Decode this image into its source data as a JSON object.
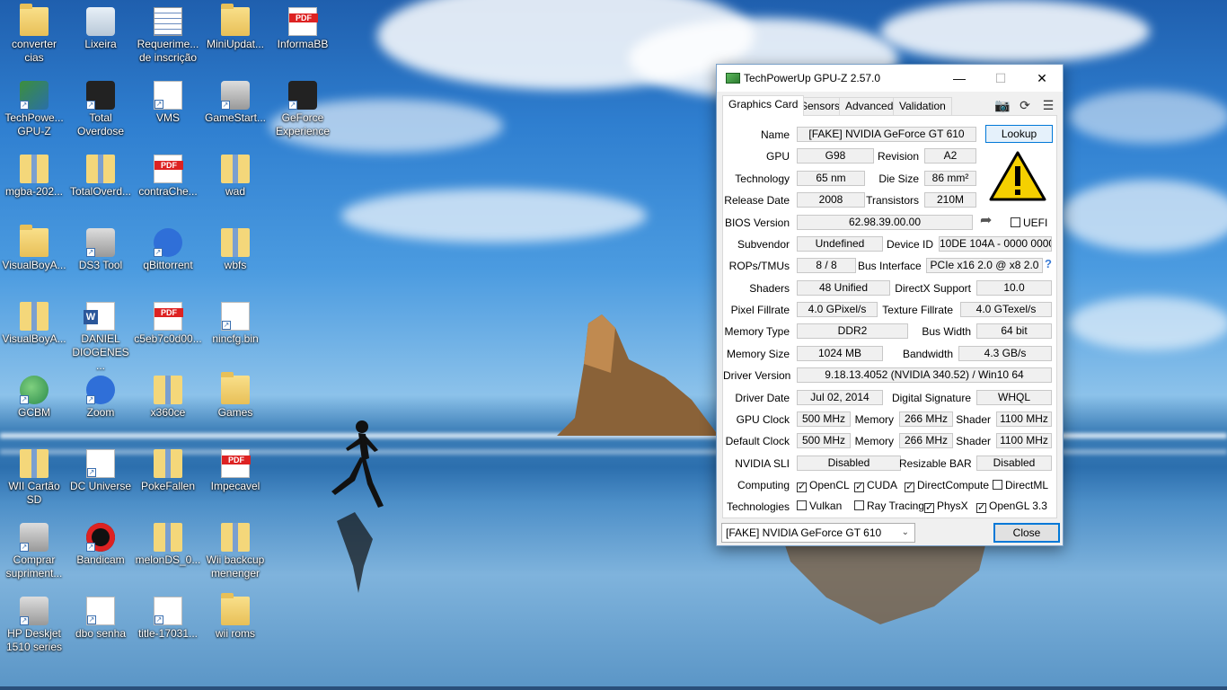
{
  "desktop": {
    "icons": [
      {
        "label": "converter\ncias",
        "glyph": "folder"
      },
      {
        "label": "Lixeira",
        "glyph": "bin"
      },
      {
        "label": "Requerime...\nde inscrição",
        "glyph": "form"
      },
      {
        "label": "MiniUpdat...",
        "glyph": "folder"
      },
      {
        "label": "InformaBB",
        "glyph": "pdf"
      },
      {
        "label": "TechPowe...\nGPU-Z",
        "glyph": "app"
      },
      {
        "label": "Total\nOverdose",
        "glyph": "dark"
      },
      {
        "label": "VMS",
        "glyph": "doc"
      },
      {
        "label": "GameStart...",
        "glyph": "gray"
      },
      {
        "label": "GeForce\nExperience",
        "glyph": "dark"
      },
      {
        "label": "mgba-202...",
        "glyph": "zip"
      },
      {
        "label": "TotalOverd...",
        "glyph": "zip"
      },
      {
        "label": "contraChe...",
        "glyph": "pdf"
      },
      {
        "label": "wad",
        "glyph": "zip"
      },
      {
        "label": "VisualBoyA...",
        "glyph": "folder"
      },
      {
        "label": "DS3 Tool",
        "glyph": "gray"
      },
      {
        "label": "qBittorrent",
        "glyph": "blue-circle"
      },
      {
        "label": "wbfs",
        "glyph": "zip"
      },
      {
        "label": "VisualBoyA...",
        "glyph": "zip"
      },
      {
        "label": "DANIEL\nDIOGENES ...",
        "glyph": "word"
      },
      {
        "label": "c5eb7c0d00...",
        "glyph": "pdf"
      },
      {
        "label": "nincfg.bin",
        "glyph": "doc"
      },
      {
        "label": "GCBM",
        "glyph": "globe"
      },
      {
        "label": "Zoom",
        "glyph": "blue-circle"
      },
      {
        "label": "x360ce",
        "glyph": "zip"
      },
      {
        "label": "Games",
        "glyph": "folder"
      },
      {
        "label": "WII Cartão\nSD",
        "glyph": "zip"
      },
      {
        "label": "DC Universe",
        "glyph": "doc"
      },
      {
        "label": "PokeFallen",
        "glyph": "zip"
      },
      {
        "label": "Impecavel",
        "glyph": "pdf"
      },
      {
        "label": "Comprar\nsupriment...",
        "glyph": "gray"
      },
      {
        "label": "Bandicam",
        "glyph": "bandicam"
      },
      {
        "label": "melonDS_0...",
        "glyph": "zip"
      },
      {
        "label": "Wii backcup\nmenenger",
        "glyph": "zip"
      },
      {
        "label": "HP Deskjet\n1510 series",
        "glyph": "gray"
      },
      {
        "label": "dbo senha",
        "glyph": "doc"
      },
      {
        "label": "title-17031...",
        "glyph": "doc"
      },
      {
        "label": "wii roms",
        "glyph": "folder"
      }
    ]
  },
  "window": {
    "title": "TechPowerUp GPU-Z 2.57.0",
    "controls": {
      "minimize": "—",
      "maximize": "☐",
      "close": "✕"
    },
    "tabs": [
      "Graphics Card",
      "Sensors",
      "Advanced",
      "Validation"
    ],
    "active_tab": "Graphics Card",
    "tool_icons": [
      "camera-icon",
      "refresh-icon",
      "menu-icon"
    ],
    "labels": {
      "name": "Name",
      "gpu": "GPU",
      "revision": "Revision",
      "technology": "Technology",
      "die_size": "Die Size",
      "release_date": "Release Date",
      "transistors": "Transistors",
      "bios_version": "BIOS Version",
      "uefi": "UEFI",
      "subvendor": "Subvendor",
      "device_id": "Device ID",
      "rops_tmus": "ROPs/TMUs",
      "bus_interface": "Bus Interface",
      "shaders": "Shaders",
      "directx_support": "DirectX Support",
      "pixel_fillrate": "Pixel Fillrate",
      "texture_fillrate": "Texture Fillrate",
      "memory_type": "Memory Type",
      "bus_width": "Bus Width",
      "memory_size": "Memory Size",
      "bandwidth": "Bandwidth",
      "driver_version": "Driver Version",
      "driver_date": "Driver Date",
      "digital_signature": "Digital Signature",
      "gpu_clock": "GPU Clock",
      "memory": "Memory",
      "shader": "Shader",
      "default_clock": "Default Clock",
      "nvidia_sli": "NVIDIA SLI",
      "resizable_bar": "Resizable BAR",
      "computing": "Computing",
      "technologies": "Technologies"
    },
    "values": {
      "name": "[FAKE] NVIDIA GeForce GT 610",
      "gpu": "G98",
      "revision": "A2",
      "technology": "65 nm",
      "die_size": "86 mm²",
      "release_date": "2008",
      "transistors": "210M",
      "bios_version": "62.98.39.00.00",
      "subvendor": "Undefined",
      "device_id": "10DE 104A - 0000 0000",
      "rops_tmus": "8 / 8",
      "bus_interface": "PCIe x16 2.0 @ x8 2.0",
      "shaders": "48 Unified",
      "directx_support": "10.0",
      "pixel_fillrate": "4.0 GPixel/s",
      "texture_fillrate": "4.0 GTexel/s",
      "memory_type": "DDR2",
      "bus_width": "64 bit",
      "memory_size": "1024 MB",
      "bandwidth": "4.3 GB/s",
      "driver_version": "9.18.13.4052 (NVIDIA 340.52) / Win10 64",
      "driver_date": "Jul 02, 2014",
      "digital_signature": "WHQL",
      "gpu_clock": "500 MHz",
      "gpu_memory_clock": "266 MHz",
      "gpu_shader_clock": "1100 MHz",
      "default_clock": "500 MHz",
      "default_memory_clock": "266 MHz",
      "default_shader_clock": "1100 MHz",
      "nvidia_sli": "Disabled",
      "resizable_bar": "Disabled"
    },
    "lookup_button": "Lookup",
    "bus_help": "?",
    "uefi_checked": false,
    "computing": [
      {
        "label": "OpenCL",
        "checked": true
      },
      {
        "label": "CUDA",
        "checked": true
      },
      {
        "label": "DirectCompute",
        "checked": true
      },
      {
        "label": "DirectML",
        "checked": false
      }
    ],
    "technologies": [
      {
        "label": "Vulkan",
        "checked": false
      },
      {
        "label": "Ray Tracing",
        "checked": false
      },
      {
        "label": "PhysX",
        "checked": true
      },
      {
        "label": "OpenGL 3.3",
        "checked": true
      }
    ],
    "device_select": "[FAKE] NVIDIA GeForce GT 610",
    "close_button": "Close"
  }
}
